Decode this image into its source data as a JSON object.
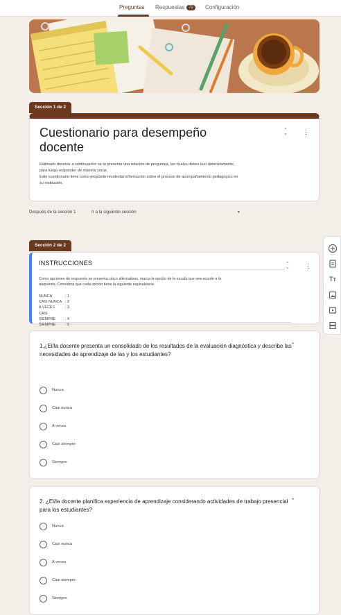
{
  "tabs": [
    {
      "label": "Preguntas"
    },
    {
      "label": "Respuestas",
      "badge": "72"
    },
    {
      "label": "Configuración"
    }
  ],
  "section1": {
    "label": "Sección 1 de 2",
    "title": "Cuestionario para desempeño docente",
    "description": [
      "Estimado docente a continuación se te presenta una relación de preguntas, las cuales debes leer detenidamente,",
      "para luego responder de manera veraz.",
      "Este cuestionario tiene como propósito recolectar información sobre el proceso de acompañamiento pedagógico en",
      "su institución."
    ]
  },
  "after_section": {
    "label": "Después de la sección 1",
    "value": "Ir a la siguiente sección"
  },
  "section2": {
    "label": "Sección 2 de 2",
    "title": "INSTRUCCIONES",
    "text": [
      "Como opciones de respuesta se presenta cinco alternativas, marca la opción de la escala que sea acorde a la",
      "respuesta. Considera que cada opción tiene la siguiente equivalencia."
    ],
    "scale": [
      {
        "label": "NUNCA",
        "value": ": 1"
      },
      {
        "label": "CASI NUNCA",
        "value": ": 2"
      },
      {
        "label": "A VECES",
        "value": ": 3"
      },
      {
        "label": "CASI SIEMPRE",
        "value": ": 4"
      },
      {
        "label": "SIEMPRE",
        "value": ": 5"
      }
    ]
  },
  "questions": [
    {
      "text": "1.¿El/la docente presenta un consolidado de los resultados de la evaluación diagnóstica y describe las necesidades de aprendizaje de las y los estudiantes?",
      "required": "*",
      "options": [
        "Nunca",
        "Casi nunca",
        "A veces",
        "Casi siempre",
        "Siempre"
      ]
    },
    {
      "text": "2. ¿El/la docente planifica experiencia de aprendizaje considerando actividades de trabajo presencial para los estudiantes?",
      "required": "*",
      "options": [
        "Nunca",
        "Casi nunca",
        "A veces",
        "Casi siempre",
        "Siempre"
      ]
    }
  ],
  "icons": {
    "collapse": "⌃⌄",
    "more": "⋮"
  },
  "colors": {
    "theme": "#6b3a1e",
    "background": "#f4eee8",
    "focus_border": "#4285f4",
    "required": "#d93025"
  }
}
